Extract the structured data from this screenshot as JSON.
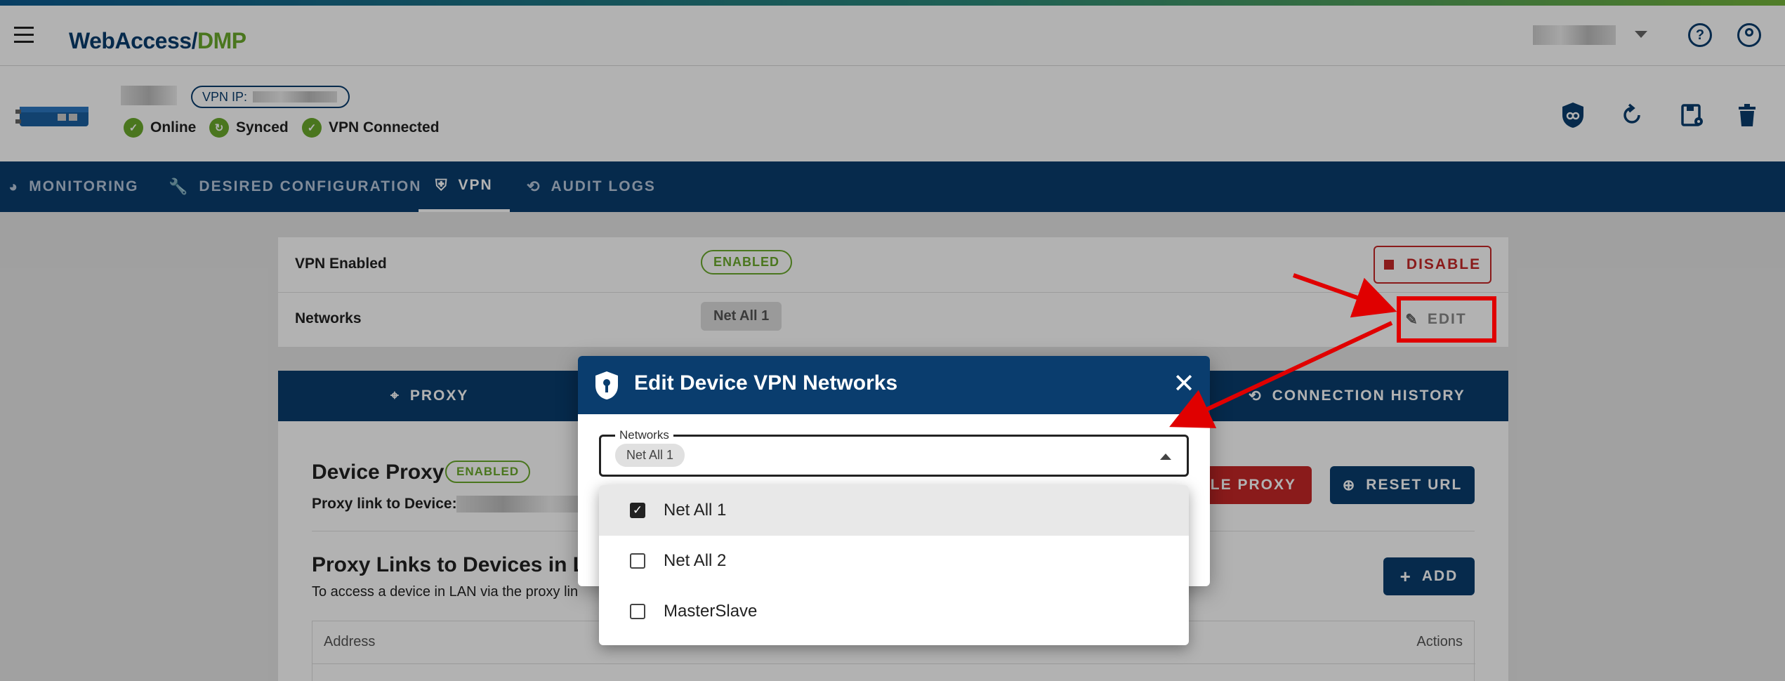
{
  "brand": {
    "part1": "WebAccess/",
    "part2": "DMP"
  },
  "device": {
    "vpn_ip_label": "VPN IP:",
    "statuses": [
      {
        "label": "Online"
      },
      {
        "label": "Synced"
      },
      {
        "label": "VPN Connected"
      }
    ]
  },
  "tabs": [
    {
      "label": "MONITORING",
      "icon": "pie-chart-icon"
    },
    {
      "label": "DESIRED CONFIGURATION",
      "icon": "wrench-icon"
    },
    {
      "label": "VPN",
      "icon": "shield-icon",
      "active": true
    },
    {
      "label": "AUDIT LOGS",
      "icon": "history-icon"
    }
  ],
  "vpn": {
    "enabled_label": "VPN Enabled",
    "enabled_status": "ENABLED",
    "disable_button": "DISABLE",
    "networks_label": "Networks",
    "networks_value": "Net All 1",
    "edit_button": "EDIT"
  },
  "subtabs": {
    "proxy": "PROXY",
    "history": "CONNECTION HISTORY"
  },
  "proxy": {
    "title": "Device Proxy",
    "status": "ENABLED",
    "link_label": "Proxy link to Device:",
    "disable_proxy": "BLE PROXY",
    "reset_url": "RESET URL",
    "links_title": "Proxy Links to Devices in LA",
    "links_desc": "To access a device in LAN via the proxy lin",
    "add_button": "ADD",
    "col_address": "Address",
    "col_actions": "Actions"
  },
  "dialog": {
    "title": "Edit Device VPN Networks",
    "field_label": "Networks",
    "selected_chip": "Net All 1",
    "options": [
      {
        "label": "Net All 1",
        "checked": true
      },
      {
        "label": "Net All 2",
        "checked": false
      },
      {
        "label": "MasterSlave",
        "checked": false
      }
    ]
  },
  "colors": {
    "brand_blue": "#0a3d6e",
    "brand_green": "#6aaa2c",
    "danger": "#c62828",
    "annotation": "#e00000"
  }
}
